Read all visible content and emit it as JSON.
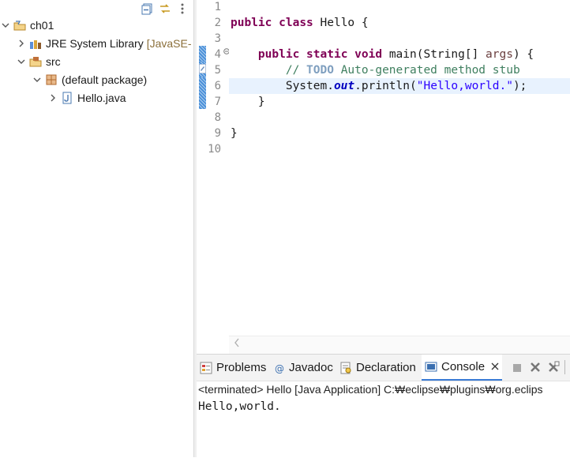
{
  "explorer": {
    "project": "ch01",
    "jre": {
      "label": "JRE System Library",
      "decoration": "[JavaSE-"
    },
    "src": "src",
    "package": "(default package)",
    "file": "Hello.java"
  },
  "editor": {
    "line_numbers": [
      "1",
      "2",
      "3",
      "4",
      "5",
      "6",
      "7",
      "8",
      "9",
      "10"
    ],
    "code": {
      "l2_kw1": "public",
      "l2_kw2": "class",
      "l2_rest": " Hello {",
      "l4_kw1": "public",
      "l4_kw2": "static",
      "l4_kw3": "void",
      "l4_mid": " main(String[] ",
      "l4_param": "args",
      "l4_end": ") {",
      "l5_slash": "// ",
      "l5_todo": "TODO",
      "l5_rest": " Auto-generated method stub",
      "l6_a": "System.",
      "l6_field": "out",
      "l6_b": ".println(",
      "l6_str": "\"Hello,world.\"",
      "l6_c": ");",
      "l7": "}",
      "l9": "}"
    }
  },
  "bottom": {
    "tabs": [
      "Problems",
      "Javadoc",
      "Declaration",
      "Console"
    ],
    "console_header": "<terminated> Hello [Java Application] C:₩eclipse₩plugins₩org.eclips",
    "console_output": "Hello,world."
  },
  "colors": {
    "keyword": "#7f0055",
    "comment": "#3f7f5f",
    "string": "#2a00ff",
    "field": "#0000c0",
    "current_line": "#e8f2fe"
  }
}
